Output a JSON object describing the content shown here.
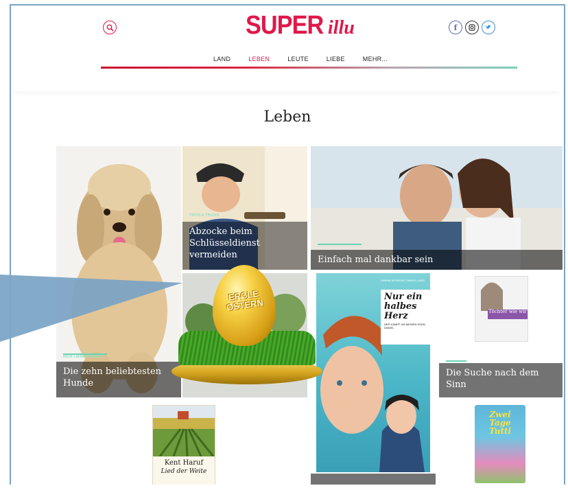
{
  "header": {
    "logo_super": "SUPER",
    "logo_illu": "illu",
    "nav": [
      "LAND",
      "LEBEN",
      "LEUTE",
      "LIEBE",
      "MEHR..."
    ],
    "active_nav": "LEBEN",
    "social": [
      "f",
      "◎",
      "t"
    ]
  },
  "page": {
    "title": "Leben"
  },
  "tiles": {
    "dog": {
      "tag": "MEIN LIEBLINGSTIER",
      "caption": "Die zehn beliebtesten Hunde"
    },
    "key": {
      "tag": "TIPPS & TRICKS",
      "caption": "Abzocke beim Schlüsseldienst vermeiden"
    },
    "couple": {
      "caption": "Einfach mal dankbar sein"
    },
    "book": {
      "author_line": "DEBBIE WYNN MIT SANDIE LANG",
      "title": "Nur ein halbes Herz",
      "subtitle": "DER KAMPF UM MEINEN SOHN DANIEL"
    },
    "toechter": {
      "cover_title": "Töchter wie wir",
      "caption": "Die Suche nach dem Sinn"
    },
    "haruf": {
      "author": "Kent Haruf",
      "subtitle": "Lied der Weite"
    },
    "dvd": {
      "title": "Zwei Tage Tutti"
    }
  },
  "easter": {
    "egg_text": "ERCLE OSTERN"
  },
  "colors": {
    "brand": "#e0184a",
    "accent": "#6ad3b3",
    "pointer": "#7aa3c4"
  }
}
